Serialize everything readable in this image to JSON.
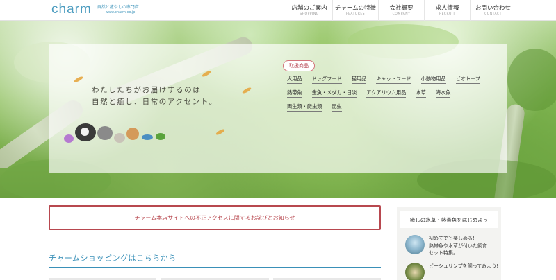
{
  "header": {
    "logo": "charm",
    "logo_tagline": "自然と癒やしの専門店",
    "logo_url": "www.charm.co.jp",
    "nav": [
      {
        "jp": "店舗のご案内",
        "en": "SHOPPING"
      },
      {
        "jp": "チャームの特徴",
        "en": "FEATURES"
      },
      {
        "jp": "会社概要",
        "en": "COMPANY"
      },
      {
        "jp": "求人情報",
        "en": "RECRUIT"
      },
      {
        "jp": "お問い合わせ",
        "en": "CONTACT"
      }
    ]
  },
  "hero": {
    "tagline_line1": "わたしたちがお届けするのは",
    "tagline_line2": "自然と癒し、日常のアクセント。",
    "badge": "取扱商品",
    "categories": [
      "犬用品",
      "ドッグフード",
      "猫用品",
      "キャットフード",
      "小動物用品",
      "ビオトープ",
      "熱帯魚",
      "金魚・メダカ・日淡",
      "アクアリウム用品",
      "水草",
      "海水魚",
      "両生類・爬虫類",
      "昆虫"
    ]
  },
  "notice": "チャーム本店サイトへの不正アクセスに関するお詫びとお知らせ",
  "section_title": "チャームショッピングはこちらから",
  "sidebar": {
    "heading": "癒しの水草・熱帯魚をはじめよう",
    "items": [
      {
        "line1": "初めてでも楽しめる!",
        "line2": "熱帯魚や水草が付いた飼育",
        "line3": "セット特集。"
      },
      {
        "line1": "ビーシュリンプを飼ってみよう!",
        "line2": "",
        "line3": ""
      }
    ]
  },
  "colors": {
    "accent_blue": "#3a90b8",
    "notice_red": "#b8484f",
    "badge_pink": "#d4727a"
  }
}
